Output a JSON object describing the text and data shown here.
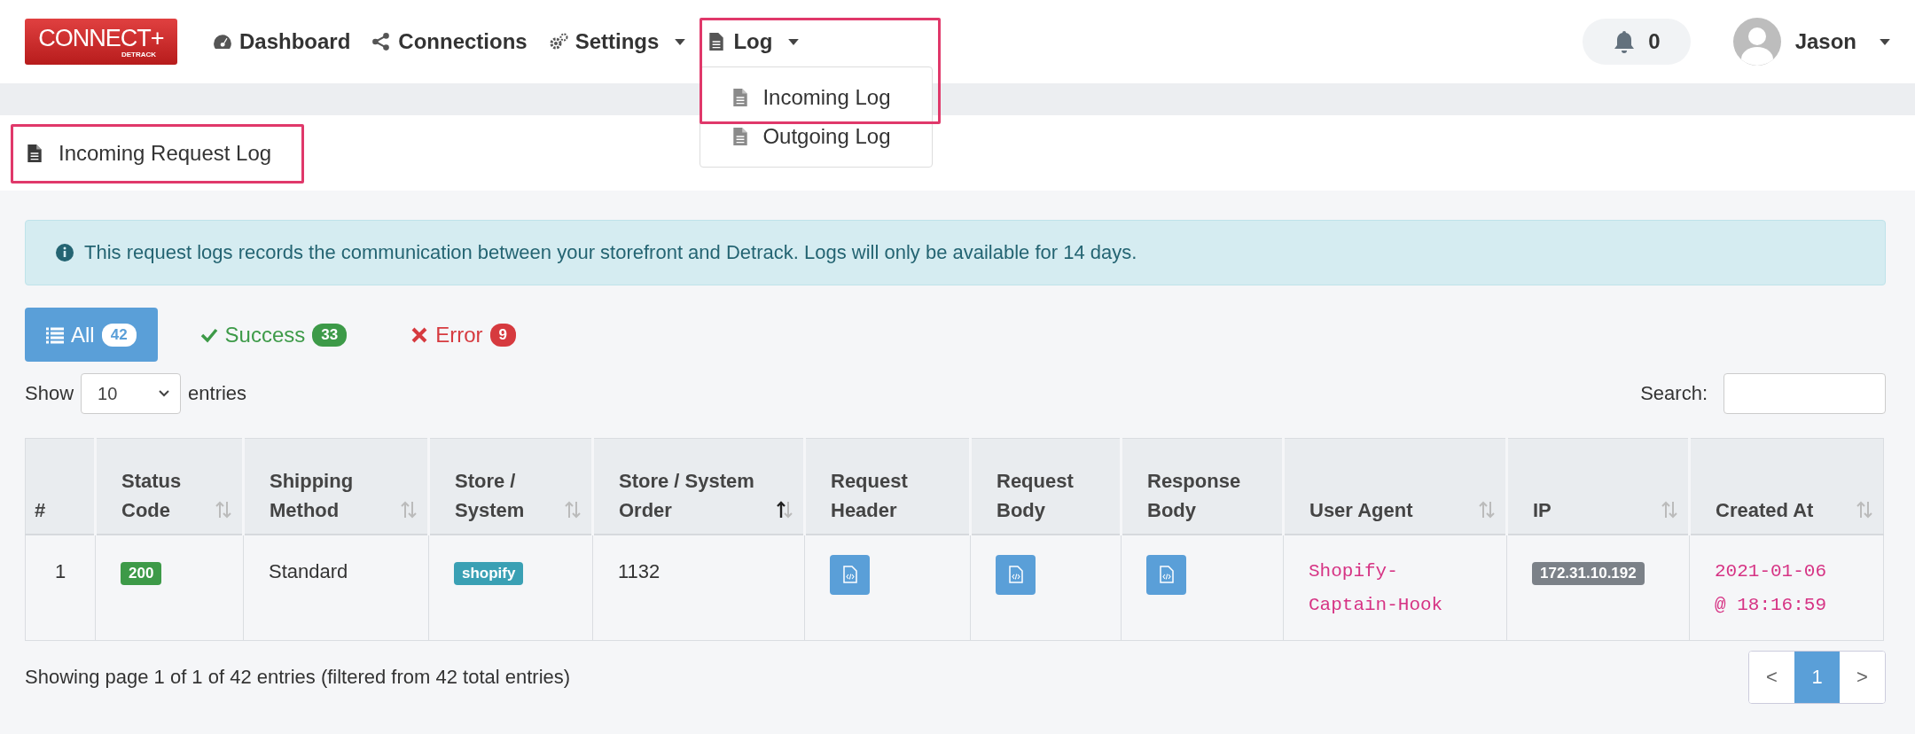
{
  "nav": {
    "logo": {
      "title": "CONNECT+",
      "subtitle": "DETRACK"
    },
    "items": [
      {
        "label": "Dashboard",
        "has_menu": false
      },
      {
        "label": "Connections",
        "has_menu": false
      },
      {
        "label": "Settings",
        "has_menu": true,
        "expanded": false
      },
      {
        "label": "Log",
        "has_menu": true,
        "expanded": true,
        "highlighted": true,
        "menu": [
          {
            "label": "Incoming Log"
          },
          {
            "label": "Outgoing Log"
          }
        ]
      }
    ],
    "notifications": "0",
    "user": "Jason"
  },
  "page_title": {
    "text": "Incoming Request Log",
    "highlighted": true
  },
  "alert": "This request logs records the communication between your storefront and Detrack. Logs will only be available for 14 days.",
  "filters": [
    {
      "label": "All",
      "count": "42",
      "kind": "all",
      "selected": true
    },
    {
      "label": "Success",
      "count": "33",
      "kind": "success",
      "selected": false
    },
    {
      "label": "Error",
      "count": "9",
      "kind": "error",
      "selected": false
    }
  ],
  "length": {
    "before": "Show",
    "value": "10",
    "after": "entries"
  },
  "search": {
    "label": "Search:"
  },
  "table": {
    "columns": [
      {
        "label": "#",
        "sortable": false
      },
      {
        "label": "Status Code",
        "sortable": true,
        "sorted": false
      },
      {
        "label": "Shipping Method",
        "sortable": true,
        "sorted": false
      },
      {
        "label": "Store / System",
        "sortable": true,
        "sorted": false
      },
      {
        "label": "Store / System Order",
        "sortable": true,
        "sorted": true
      },
      {
        "label": "Request Header",
        "sortable": false
      },
      {
        "label": "Request Body",
        "sortable": false
      },
      {
        "label": "Response Body",
        "sortable": false
      },
      {
        "label": "User Agent",
        "sortable": true,
        "sorted": false
      },
      {
        "label": "IP",
        "sortable": true,
        "sorted": false
      },
      {
        "label": "Created At",
        "sortable": true,
        "sorted": false
      }
    ],
    "rows": [
      {
        "cells": [
          {
            "kind": "text",
            "text": "1"
          },
          {
            "kind": "success-badge",
            "text": "200"
          },
          {
            "kind": "text",
            "text": "Standard"
          },
          {
            "kind": "info-badge",
            "text": "shopify"
          },
          {
            "kind": "text",
            "text": "1132"
          },
          {
            "kind": "code-button"
          },
          {
            "kind": "code-button"
          },
          {
            "kind": "code-button"
          },
          {
            "kind": "mono",
            "text": "Shopify-Captain-Hook"
          },
          {
            "kind": "dark-badge",
            "text": "172.31.10.192"
          },
          {
            "kind": "mono",
            "text": "2021-01-06 @ 18:16:59"
          }
        ]
      }
    ]
  },
  "footer": {
    "info": "Showing page 1 of 1 of 42 entries (filtered from 42 total entries)",
    "previous": "<",
    "pages": [
      {
        "label": "1",
        "selected": true
      }
    ],
    "next": ">"
  }
}
